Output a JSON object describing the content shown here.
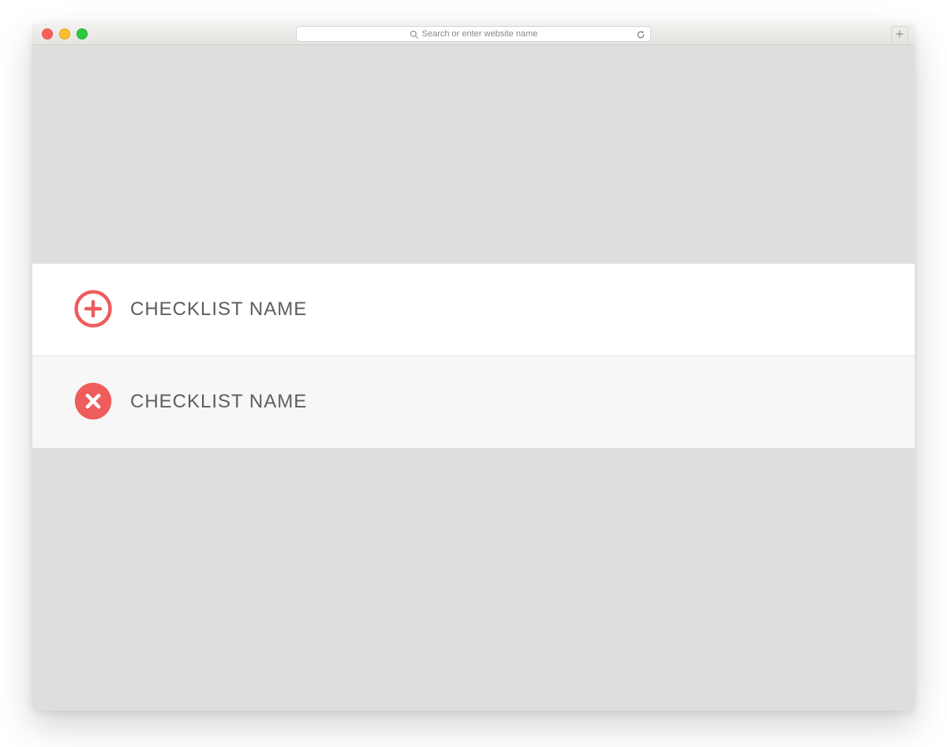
{
  "browser": {
    "address_placeholder": "Search or enter website name"
  },
  "rows": [
    {
      "icon": "plus-circle",
      "label": "CHECKLIST NAME"
    },
    {
      "icon": "x-circle",
      "label": "CHECKLIST NAME"
    }
  ],
  "colors": {
    "accent": "#ef5c5c",
    "page_bg": "#dedede",
    "row_add_bg": "#ffffff",
    "row_remove_bg": "#f7f7f7",
    "label_text": "#5d5d5d"
  }
}
